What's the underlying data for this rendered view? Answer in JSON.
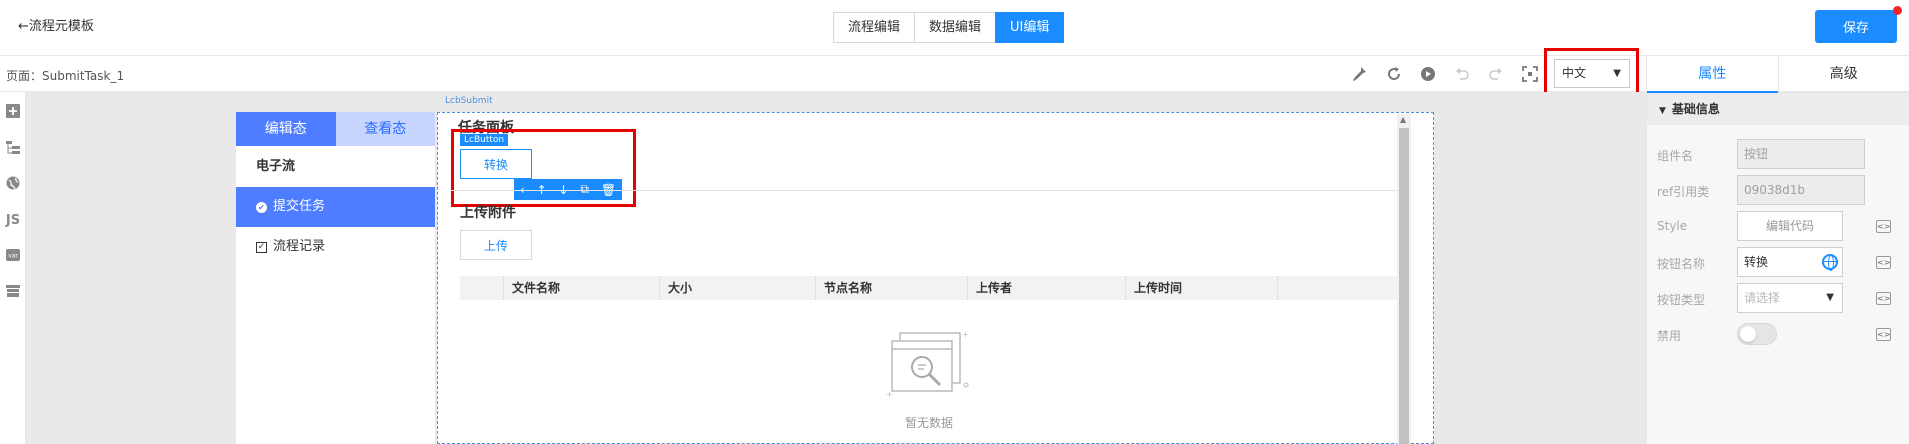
{
  "topbar": {
    "back_label": "←流程元模板",
    "tabs": [
      {
        "label": "流程编辑",
        "active": false
      },
      {
        "label": "数据编辑",
        "active": false
      },
      {
        "label": "UI编辑",
        "active": true
      }
    ],
    "save_label": "保存"
  },
  "toolbar": {
    "page_label": "页面：SubmitTask_1",
    "icons": [
      "broom-icon",
      "refresh-icon",
      "play-icon",
      "undo-icon",
      "redo-icon",
      "fullscreen-icon"
    ],
    "language": "中文"
  },
  "right_panel": {
    "tabs": [
      "属性",
      "高级"
    ],
    "section_title": "基础信息",
    "props": {
      "component_name": {
        "label": "组件名",
        "value": "按钮"
      },
      "ref_class": {
        "label": "ref引用类",
        "value": "09038d1b"
      },
      "style": {
        "label": "Style",
        "value": "编辑代码"
      },
      "button_name": {
        "label": "按钮名称",
        "value": "转换"
      },
      "button_type": {
        "label": "按钮类型",
        "placeholder": "请选择"
      },
      "disabled": {
        "label": "禁用",
        "value": false
      }
    }
  },
  "left_bar": {
    "icons": [
      "plus-square-icon",
      "tree-icon",
      "globe-icon",
      "js-icon",
      "var-icon",
      "database-icon"
    ],
    "js_text": "JS",
    "var_text": "var"
  },
  "preview": {
    "frame_tag": "LcbSubmit",
    "nav": {
      "tabs": [
        "编辑态",
        "查看态"
      ],
      "title": "电子流",
      "items": [
        {
          "label": "提交任务",
          "active": true
        },
        {
          "label": "流程记录",
          "active": false
        }
      ]
    },
    "task_panel_title": "任务面板",
    "lc_tag": "LcButton",
    "convert_label": "转换",
    "upload_section_title": "上传附件",
    "upload_label": "上传",
    "table_headers": [
      "",
      "文件名称",
      "大小",
      "节点名称",
      "上传者",
      "上传时间",
      ""
    ],
    "empty_text": "暂无数据"
  },
  "colors": {
    "accent": "#1a8cff",
    "nav_active": "#4f7dff",
    "nav_inactive": "#c6d6ff",
    "highlight": "#e60000"
  }
}
